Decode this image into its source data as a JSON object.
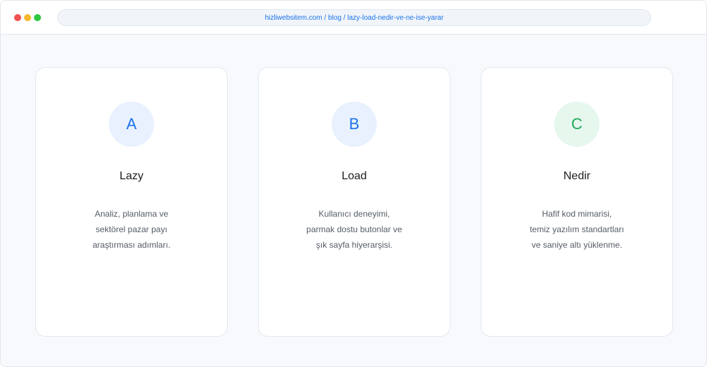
{
  "browser": {
    "url": "hizliwebsitem.com / blog / lazy-load-nedir-ve-ne-ise-yarar"
  },
  "cards": [
    {
      "badge": "A",
      "title": "Lazy",
      "desc": [
        "Analiz, planlama ve",
        "sektörel pazar payı",
        "araştırması adımları."
      ]
    },
    {
      "badge": "B",
      "title": "Load",
      "desc": [
        "Kullanıcı deneyimi,",
        "parmak dostu butonlar ve",
        "şık sayfa hiyerarşisi."
      ]
    },
    {
      "badge": "C",
      "title": "Nedir",
      "desc": [
        "Hafif kod mimarisi,",
        "temiz yazılım standartları",
        "ve saniye altı yüklenme."
      ]
    }
  ],
  "colors": {
    "accent_blue": "#1a73e8",
    "accent_green": "#1fa85a"
  }
}
